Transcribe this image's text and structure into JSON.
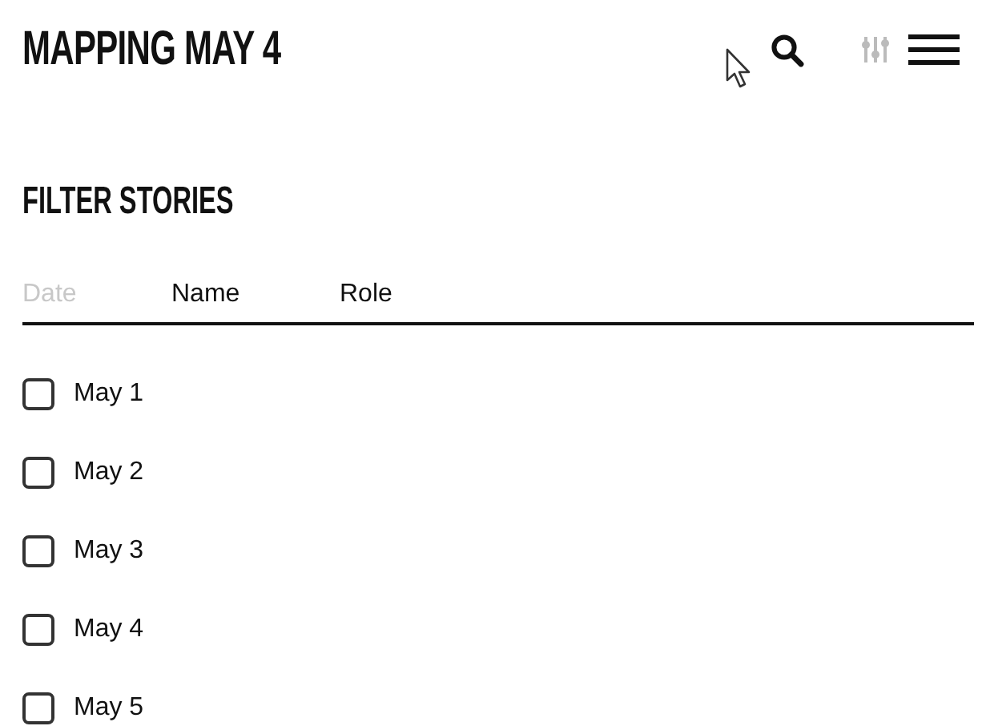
{
  "header": {
    "title": "MAPPING MAY 4"
  },
  "filter": {
    "heading": "FILTER STORIES",
    "tabs": [
      {
        "label": "Date",
        "selected": true
      },
      {
        "label": "Name",
        "selected": false
      },
      {
        "label": "Role",
        "selected": false
      }
    ],
    "options": [
      {
        "label": "May 1",
        "checked": false
      },
      {
        "label": "May 2",
        "checked": false
      },
      {
        "label": "May 3",
        "checked": false
      },
      {
        "label": "May 4",
        "checked": false
      },
      {
        "label": "May 5",
        "checked": false
      }
    ]
  }
}
